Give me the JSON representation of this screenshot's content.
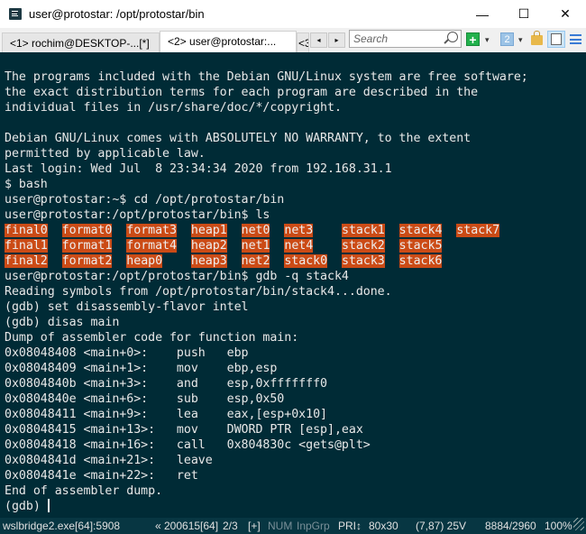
{
  "window": {
    "title": "user@protostar: /opt/protostar/bin",
    "controls": {
      "minimize": "—",
      "maximize": "☐",
      "close": "✕"
    }
  },
  "tabs": [
    {
      "label": "<1> rochim@DESKTOP-...[*]",
      "active": false
    },
    {
      "label": "<2> user@protostar:...",
      "active": true
    },
    {
      "label": "<3",
      "active": false
    }
  ],
  "toolbar": {
    "prev_label": "◂",
    "next_label": "▸",
    "search_placeholder": "Search",
    "new_console_label": "+",
    "dropdown_label": "▾",
    "console_number_label": "2"
  },
  "terminal": {
    "lines_before": [
      "",
      "The programs included with the Debian GNU/Linux system are free software;",
      "the exact distribution terms for each program are described in the",
      "individual files in /usr/share/doc/*/copyright.",
      "",
      "Debian GNU/Linux comes with ABSOLUTELY NO WARRANTY, to the extent",
      "permitted by applicable law.",
      "Last login: Wed Jul  8 23:34:34 2020 from 192.168.31.1",
      "$ bash",
      "user@protostar:~$ cd /opt/protostar/bin",
      "user@protostar:/opt/protostar/bin$ ls"
    ],
    "ls_rows": [
      [
        "final0",
        "format0",
        "format3",
        "heap1",
        "net0",
        "net3",
        "stack1",
        "stack4",
        "stack7"
      ],
      [
        "final1",
        "format1",
        "format4",
        "heap2",
        "net1",
        "net4",
        "stack2",
        "stack5"
      ],
      [
        "final2",
        "format2",
        "heap0",
        "heap3",
        "net2",
        "stack0",
        "stack3",
        "stack6"
      ]
    ],
    "lines_after": [
      "user@protostar:/opt/protostar/bin$ gdb -q stack4",
      "Reading symbols from /opt/protostar/bin/stack4...done.",
      "(gdb) set disassembly-flavor intel",
      "(gdb) disas main",
      "Dump of assembler code for function main:",
      "0x08048408 <main+0>:    push   ebp",
      "0x08048409 <main+1>:    mov    ebp,esp",
      "0x0804840b <main+3>:    and    esp,0xfffffff0",
      "0x0804840e <main+6>:    sub    esp,0x50",
      "0x08048411 <main+9>:    lea    eax,[esp+0x10]",
      "0x08048415 <main+13>:   mov    DWORD PTR [esp],eax",
      "0x08048418 <main+16>:   call   0x804830c <gets@plt>",
      "0x0804841d <main+21>:   leave",
      "0x0804841e <main+22>:   ret",
      "End of assembler dump."
    ],
    "prompt": "(gdb) ",
    "colors": {
      "background": "#002b36",
      "foreground": "#e8e8e8",
      "ls_highlight": "#cb4b16"
    }
  },
  "statusbar": {
    "process": "wslbridge2.exe[64]:5908",
    "server": "« 200615[64]",
    "console_index": "2/3",
    "plus": "[+]",
    "num": "NUM",
    "inpgrp": "InpGrp",
    "priority": "PRI↕",
    "size": "80x30",
    "cursor_pos": "(7,87) 25V",
    "buffer": "8884/2960",
    "zoom": "100%"
  }
}
